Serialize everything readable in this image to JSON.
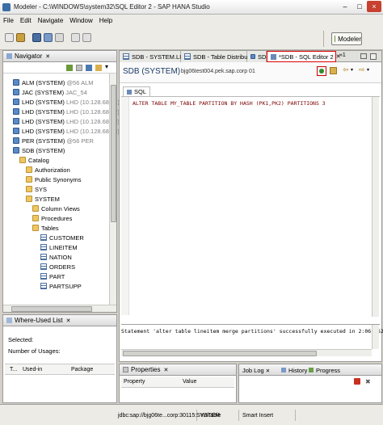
{
  "window": {
    "title": "Modeler - C:\\WINDOWS\\system32\\SQL Editor 2 - SAP HANA Studio"
  },
  "menu": {
    "items": [
      "File",
      "Edit",
      "Navigate",
      "Window",
      "Help"
    ]
  },
  "perspective": {
    "label": "Modeler"
  },
  "navigator": {
    "tab_label": "Navigator",
    "items": [
      {
        "name": "ALM (SYSTEM)",
        "suffix": "@56 ALM",
        "icon": "database-icon",
        "level": 0
      },
      {
        "name": "JAC (SYSTEM)",
        "suffix": "JAC_54",
        "icon": "database-icon",
        "level": 0
      },
      {
        "name": "LHD (SYSTEM)",
        "suffix": "LHD (10.128.68.61)",
        "icon": "database-icon",
        "level": 0
      },
      {
        "name": "LHD (SYSTEM)",
        "suffix": "LHD (10.128.68.62)",
        "icon": "database-icon",
        "level": 0
      },
      {
        "name": "LHD (SYSTEM)",
        "suffix": "LHD (10.128.68.63)",
        "icon": "database-icon",
        "level": 0
      },
      {
        "name": "LHD (SYSTEM)",
        "suffix": "LHD (10.128.68.64)",
        "icon": "database-icon",
        "level": 0
      },
      {
        "name": "PER (SYSTEM)",
        "suffix": "@56 PER",
        "icon": "database-icon",
        "level": 0
      },
      {
        "name": "SDB (SYSTEM)",
        "suffix": "",
        "icon": "database-icon",
        "level": 0
      },
      {
        "name": "Catalog",
        "suffix": "",
        "icon": "folder-icon",
        "level": 1
      },
      {
        "name": "Authorization",
        "suffix": "",
        "icon": "folder-icon",
        "level": 2
      },
      {
        "name": "Public Synonyms",
        "suffix": "",
        "icon": "folder-icon",
        "level": 2
      },
      {
        "name": "SYS",
        "suffix": "",
        "icon": "folder-icon",
        "level": 2
      },
      {
        "name": "SYSTEM",
        "suffix": "",
        "icon": "folder-icon",
        "level": 2
      },
      {
        "name": "Column Views",
        "suffix": "",
        "icon": "folder-icon",
        "level": 3
      },
      {
        "name": "Procedures",
        "suffix": "",
        "icon": "folder-icon",
        "level": 3
      },
      {
        "name": "Tables",
        "suffix": "",
        "icon": "folder-icon",
        "level": 3
      },
      {
        "name": "CUSTOMER",
        "suffix": "",
        "icon": "table-icon",
        "level": 4
      },
      {
        "name": "LINEITEM",
        "suffix": "",
        "icon": "table-icon",
        "level": 4
      },
      {
        "name": "NATION",
        "suffix": "",
        "icon": "table-icon",
        "level": 4
      },
      {
        "name": "ORDERS",
        "suffix": "",
        "icon": "table-icon",
        "level": 4
      },
      {
        "name": "PART",
        "suffix": "",
        "icon": "table-icon",
        "level": 4
      },
      {
        "name": "PARTSUPP",
        "suffix": "",
        "icon": "table-icon",
        "level": 4
      }
    ]
  },
  "where_used": {
    "tab_label": "Where-Used List",
    "selected_label": "Selected:",
    "usages_label": "Number of Usages:",
    "columns": [
      "T...",
      "Used-in",
      "Package"
    ]
  },
  "editor": {
    "tabs": [
      {
        "label": "SDB - SYSTEM.LINEITE",
        "active": false
      },
      {
        "label": "SDB - Table Distribu",
        "active": false
      },
      {
        "label": "SDB",
        "active": false
      },
      {
        "label": "*SDB - SQL Editor 2",
        "active": true
      }
    ],
    "overflow_count": "1",
    "header_title": "SDB (SYSTEM)",
    "header_host": "bjg06test004.pek.sap.corp 01",
    "sql_tab_label": "SQL",
    "sql_text": "ALTER TABLE MY_TABLE PARTITION BY HASH (PK1,PK2) PARTITIONS 3",
    "result_text": "Statement 'alter table lineitem merge partitions' successfully executed in 2:06.962 m"
  },
  "properties": {
    "tab_label": "Properties",
    "columns": [
      "Property",
      "Value"
    ]
  },
  "bottom_tabs": [
    "Job Log",
    "History",
    "Progress"
  ],
  "status": {
    "connection": "jdbc:sap://bjg06te...corp:30115:SYSTEM",
    "mode": "Writable",
    "insert": "Smart Insert"
  },
  "colors": {
    "accent_red": "#e00000",
    "sql_text": "#7a0000"
  }
}
